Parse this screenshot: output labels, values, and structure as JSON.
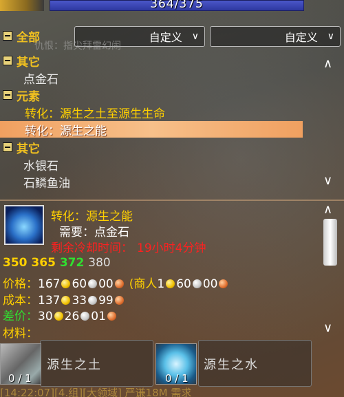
{
  "topbar": {
    "value_text": "364/375"
  },
  "dropdowns": [
    {
      "label": "自定义"
    },
    {
      "label": "自定义"
    }
  ],
  "faint_text": "仇恨：指尖拜雷幻闹",
  "list": [
    {
      "type": "cat",
      "label": "全部"
    },
    {
      "type": "cat",
      "label": "其它"
    },
    {
      "type": "item",
      "label": "点金石"
    },
    {
      "type": "cat",
      "label": "元素"
    },
    {
      "type": "recipe",
      "label": "转化：源生之土至源生生命"
    },
    {
      "type": "recipe",
      "label": "转化：源生之能",
      "selected": true
    },
    {
      "type": "cat",
      "label": "其它"
    },
    {
      "type": "item",
      "label": "水银石"
    },
    {
      "type": "item",
      "label": "石鳞鱼油"
    }
  ],
  "detail": {
    "title": "转化：源生之能",
    "requires": "需要：点金石",
    "cooldown_label": "剩余冷却时间：",
    "cooldown_value": "19小时4分钟",
    "skill_levels": [
      "350",
      "365",
      "372",
      "380"
    ],
    "price_label": "价格：",
    "price": {
      "gold": "167",
      "silver": "60",
      "copper": "00"
    },
    "vendor_label": "(商人",
    "vendor_price": {
      "gold": "1",
      "silver": "60",
      "copper": "00"
    },
    "cost_label": "成本：",
    "cost": {
      "gold": "137",
      "silver": "33",
      "copper": "99"
    },
    "diff_label": "差价：",
    "diff": {
      "gold": "30",
      "silver": "26",
      "copper": "01"
    },
    "materials_label": "材料：",
    "materials": [
      {
        "name": "源生之土",
        "count": "0 / 1"
      },
      {
        "name": "源生之水",
        "count": "0 / 1"
      }
    ]
  },
  "chat_line": "[14:22:07][4.组][大领域] 严谦18M 需求",
  "colors": {
    "category": "#f0c020",
    "recipe": "#ffd000",
    "selected_bg": "#f0a060",
    "cooldown": "#ff2020",
    "diff": "#30e030"
  }
}
